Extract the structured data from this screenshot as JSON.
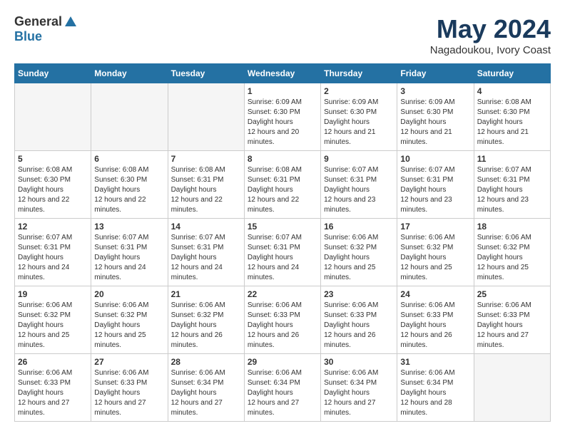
{
  "header": {
    "logo_line1": "General",
    "logo_line2": "Blue",
    "month": "May 2024",
    "location": "Nagadoukou, Ivory Coast"
  },
  "weekdays": [
    "Sunday",
    "Monday",
    "Tuesday",
    "Wednesday",
    "Thursday",
    "Friday",
    "Saturday"
  ],
  "weeks": [
    [
      {
        "day": "",
        "empty": true
      },
      {
        "day": "",
        "empty": true
      },
      {
        "day": "",
        "empty": true
      },
      {
        "day": "1",
        "sunrise": "6:09 AM",
        "sunset": "6:30 PM",
        "daylight": "12 hours and 20 minutes."
      },
      {
        "day": "2",
        "sunrise": "6:09 AM",
        "sunset": "6:30 PM",
        "daylight": "12 hours and 21 minutes."
      },
      {
        "day": "3",
        "sunrise": "6:09 AM",
        "sunset": "6:30 PM",
        "daylight": "12 hours and 21 minutes."
      },
      {
        "day": "4",
        "sunrise": "6:08 AM",
        "sunset": "6:30 PM",
        "daylight": "12 hours and 21 minutes."
      }
    ],
    [
      {
        "day": "5",
        "sunrise": "6:08 AM",
        "sunset": "6:30 PM",
        "daylight": "12 hours and 22 minutes."
      },
      {
        "day": "6",
        "sunrise": "6:08 AM",
        "sunset": "6:30 PM",
        "daylight": "12 hours and 22 minutes."
      },
      {
        "day": "7",
        "sunrise": "6:08 AM",
        "sunset": "6:31 PM",
        "daylight": "12 hours and 22 minutes."
      },
      {
        "day": "8",
        "sunrise": "6:08 AM",
        "sunset": "6:31 PM",
        "daylight": "12 hours and 22 minutes."
      },
      {
        "day": "9",
        "sunrise": "6:07 AM",
        "sunset": "6:31 PM",
        "daylight": "12 hours and 23 minutes."
      },
      {
        "day": "10",
        "sunrise": "6:07 AM",
        "sunset": "6:31 PM",
        "daylight": "12 hours and 23 minutes."
      },
      {
        "day": "11",
        "sunrise": "6:07 AM",
        "sunset": "6:31 PM",
        "daylight": "12 hours and 23 minutes."
      }
    ],
    [
      {
        "day": "12",
        "sunrise": "6:07 AM",
        "sunset": "6:31 PM",
        "daylight": "12 hours and 24 minutes."
      },
      {
        "day": "13",
        "sunrise": "6:07 AM",
        "sunset": "6:31 PM",
        "daylight": "12 hours and 24 minutes."
      },
      {
        "day": "14",
        "sunrise": "6:07 AM",
        "sunset": "6:31 PM",
        "daylight": "12 hours and 24 minutes."
      },
      {
        "day": "15",
        "sunrise": "6:07 AM",
        "sunset": "6:31 PM",
        "daylight": "12 hours and 24 minutes."
      },
      {
        "day": "16",
        "sunrise": "6:06 AM",
        "sunset": "6:32 PM",
        "daylight": "12 hours and 25 minutes."
      },
      {
        "day": "17",
        "sunrise": "6:06 AM",
        "sunset": "6:32 PM",
        "daylight": "12 hours and 25 minutes."
      },
      {
        "day": "18",
        "sunrise": "6:06 AM",
        "sunset": "6:32 PM",
        "daylight": "12 hours and 25 minutes."
      }
    ],
    [
      {
        "day": "19",
        "sunrise": "6:06 AM",
        "sunset": "6:32 PM",
        "daylight": "12 hours and 25 minutes."
      },
      {
        "day": "20",
        "sunrise": "6:06 AM",
        "sunset": "6:32 PM",
        "daylight": "12 hours and 25 minutes."
      },
      {
        "day": "21",
        "sunrise": "6:06 AM",
        "sunset": "6:32 PM",
        "daylight": "12 hours and 26 minutes."
      },
      {
        "day": "22",
        "sunrise": "6:06 AM",
        "sunset": "6:33 PM",
        "daylight": "12 hours and 26 minutes."
      },
      {
        "day": "23",
        "sunrise": "6:06 AM",
        "sunset": "6:33 PM",
        "daylight": "12 hours and 26 minutes."
      },
      {
        "day": "24",
        "sunrise": "6:06 AM",
        "sunset": "6:33 PM",
        "daylight": "12 hours and 26 minutes."
      },
      {
        "day": "25",
        "sunrise": "6:06 AM",
        "sunset": "6:33 PM",
        "daylight": "12 hours and 27 minutes."
      }
    ],
    [
      {
        "day": "26",
        "sunrise": "6:06 AM",
        "sunset": "6:33 PM",
        "daylight": "12 hours and 27 minutes."
      },
      {
        "day": "27",
        "sunrise": "6:06 AM",
        "sunset": "6:33 PM",
        "daylight": "12 hours and 27 minutes."
      },
      {
        "day": "28",
        "sunrise": "6:06 AM",
        "sunset": "6:34 PM",
        "daylight": "12 hours and 27 minutes."
      },
      {
        "day": "29",
        "sunrise": "6:06 AM",
        "sunset": "6:34 PM",
        "daylight": "12 hours and 27 minutes."
      },
      {
        "day": "30",
        "sunrise": "6:06 AM",
        "sunset": "6:34 PM",
        "daylight": "12 hours and 27 minutes."
      },
      {
        "day": "31",
        "sunrise": "6:06 AM",
        "sunset": "6:34 PM",
        "daylight": "12 hours and 28 minutes."
      },
      {
        "day": "",
        "empty": true
      }
    ]
  ]
}
